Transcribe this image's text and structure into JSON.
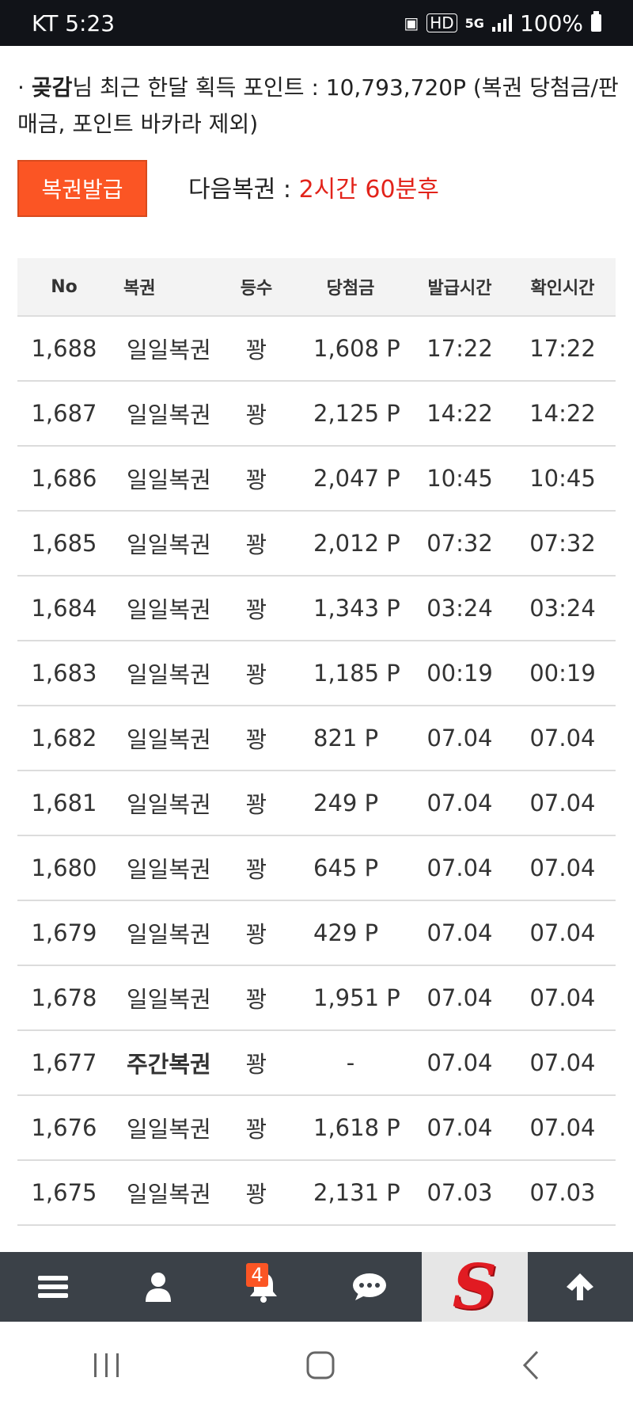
{
  "status_bar": {
    "carrier_time": "KT 5:23",
    "hd_label": "HD",
    "network": "5G",
    "battery": "100%"
  },
  "points": {
    "bullet": "·",
    "username": "곶감",
    "text": "님 최근 한달 획득 포인트 : 10,793,720P (복권 당첨금/판매금, 포인트 바카라 제외)"
  },
  "lottery": {
    "issue_button": "복권발급",
    "next_label": "다음복권 : ",
    "next_value": "2시간 60분후"
  },
  "table": {
    "headers": [
      "No",
      "복권",
      "등수",
      "당첨금",
      "발급시간",
      "확인시간"
    ],
    "rows": [
      {
        "no": "1,688",
        "type": "일일복권",
        "rank": "꽝",
        "prize": "1,608 P",
        "issued": "17:22",
        "checked": "17:22"
      },
      {
        "no": "1,687",
        "type": "일일복권",
        "rank": "꽝",
        "prize": "2,125 P",
        "issued": "14:22",
        "checked": "14:22"
      },
      {
        "no": "1,686",
        "type": "일일복권",
        "rank": "꽝",
        "prize": "2,047 P",
        "issued": "10:45",
        "checked": "10:45"
      },
      {
        "no": "1,685",
        "type": "일일복권",
        "rank": "꽝",
        "prize": "2,012 P",
        "issued": "07:32",
        "checked": "07:32"
      },
      {
        "no": "1,684",
        "type": "일일복권",
        "rank": "꽝",
        "prize": "1,343 P",
        "issued": "03:24",
        "checked": "03:24"
      },
      {
        "no": "1,683",
        "type": "일일복권",
        "rank": "꽝",
        "prize": "1,185 P",
        "issued": "00:19",
        "checked": "00:19"
      },
      {
        "no": "1,682",
        "type": "일일복권",
        "rank": "꽝",
        "prize": "821 P",
        "issued": "07.04",
        "checked": "07.04"
      },
      {
        "no": "1,681",
        "type": "일일복권",
        "rank": "꽝",
        "prize": "249 P",
        "issued": "07.04",
        "checked": "07.04"
      },
      {
        "no": "1,680",
        "type": "일일복권",
        "rank": "꽝",
        "prize": "645 P",
        "issued": "07.04",
        "checked": "07.04"
      },
      {
        "no": "1,679",
        "type": "일일복권",
        "rank": "꽝",
        "prize": "429 P",
        "issued": "07.04",
        "checked": "07.04"
      },
      {
        "no": "1,678",
        "type": "일일복권",
        "rank": "꽝",
        "prize": "1,951 P",
        "issued": "07.04",
        "checked": "07.04"
      },
      {
        "no": "1,677",
        "type": "주간복권",
        "rank": "꽝",
        "prize": "-",
        "issued": "07.04",
        "checked": "07.04"
      },
      {
        "no": "1,676",
        "type": "일일복권",
        "rank": "꽝",
        "prize": "1,618 P",
        "issued": "07.04",
        "checked": "07.04"
      },
      {
        "no": "1,675",
        "type": "일일복권",
        "rank": "꽝",
        "prize": "2,131 P",
        "issued": "07.03",
        "checked": "07.03"
      }
    ]
  },
  "bottom_nav": {
    "items": [
      "menu-icon",
      "user-icon",
      "bell-icon",
      "chat-icon",
      "logo",
      "arrow-up-icon"
    ],
    "notification_count": "4",
    "logo_letter": "S"
  },
  "colors": {
    "accent": "#fb5524",
    "next_time": "#e2231a",
    "nav_bg": "#3b4148"
  }
}
